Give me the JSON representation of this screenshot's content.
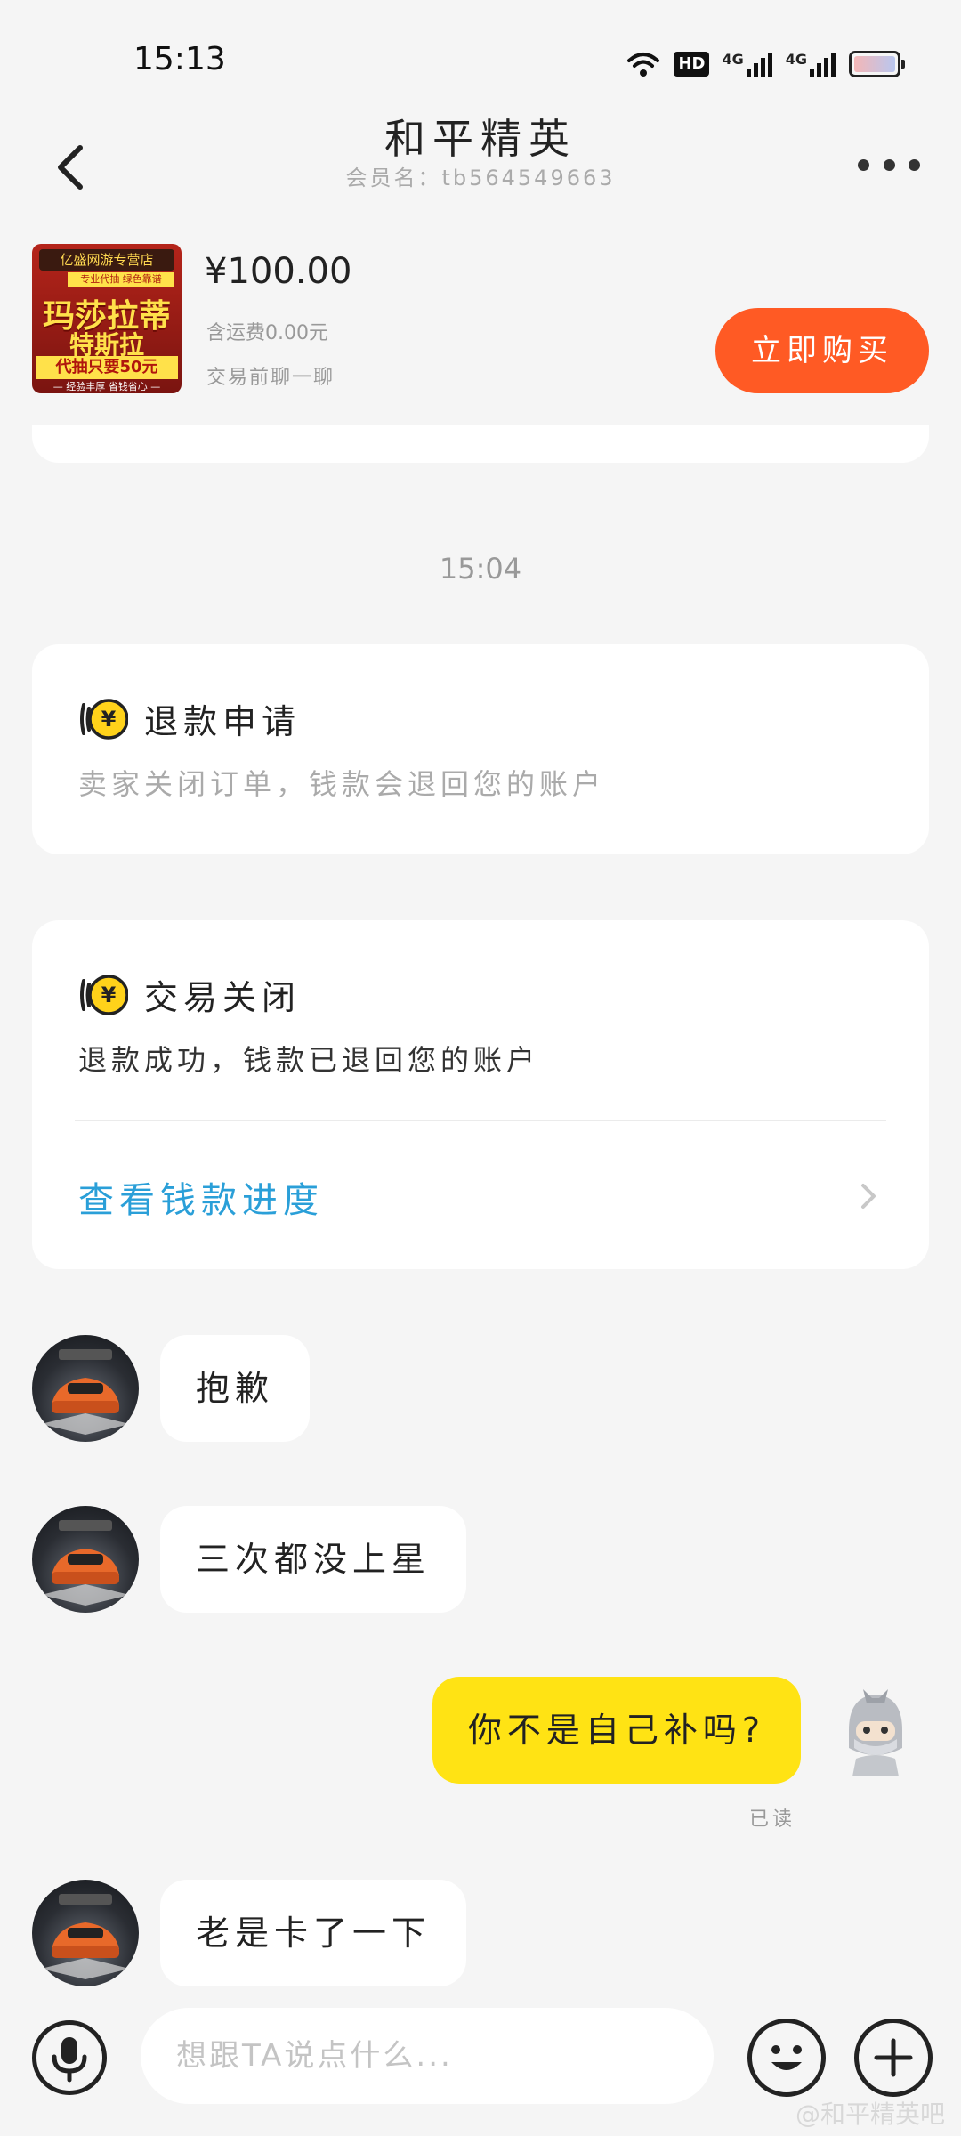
{
  "status_bar": {
    "time": "15:13",
    "hd_badge": "HD",
    "net_1": "4G",
    "net_2": "4G",
    "icons": [
      "wifi-icon",
      "hd-icon",
      "signal-4g-icon",
      "signal-4g-icon",
      "battery-icon"
    ]
  },
  "header": {
    "title": "和平精英",
    "member_name": "会员名：tb564549663",
    "back_icon": "back-arrow-icon",
    "more_icon": "more-dots-icon"
  },
  "product": {
    "price": "¥100.00",
    "shipping": "含运费0.00元",
    "chat_hint": "交易前聊一聊",
    "buy_label": "立即购买",
    "buy_color": "#ff5a24",
    "thumb": {
      "shop": "亿盛网游专营店",
      "sub": "专业代抽 绿色靠谱",
      "line1": "玛莎拉蒂",
      "line2": "特斯拉",
      "promo": "代抽只要50元",
      "footer": "— 经验丰厚 省钱省心 —"
    }
  },
  "chat": {
    "timestamp": "15:04",
    "refund_card": {
      "icon": "refund-yen-icon",
      "title": "退款申请",
      "desc": "卖家关闭订单，钱款会退回您的账户"
    },
    "close_card": {
      "icon": "refund-yen-icon",
      "title": "交易关闭",
      "desc": "退款成功，钱款已退回您的账户",
      "link": "查看钱款进度",
      "link_color": "#2a9fd8"
    },
    "messages": [
      {
        "from": "seller",
        "text": "抱歉"
      },
      {
        "from": "seller",
        "text": "三次都没上星"
      },
      {
        "from": "me",
        "text": "你不是自己补吗?",
        "status": "已读"
      },
      {
        "from": "seller",
        "text": "老是卡了一下"
      }
    ],
    "my_bubble_color": "#ffe314"
  },
  "input": {
    "placeholder": "想跟TA说点什么...",
    "voice_icon": "microphone-icon",
    "emoji_icon": "emoji-icon",
    "plus_icon": "plus-icon"
  },
  "watermark": "@和平精英吧"
}
